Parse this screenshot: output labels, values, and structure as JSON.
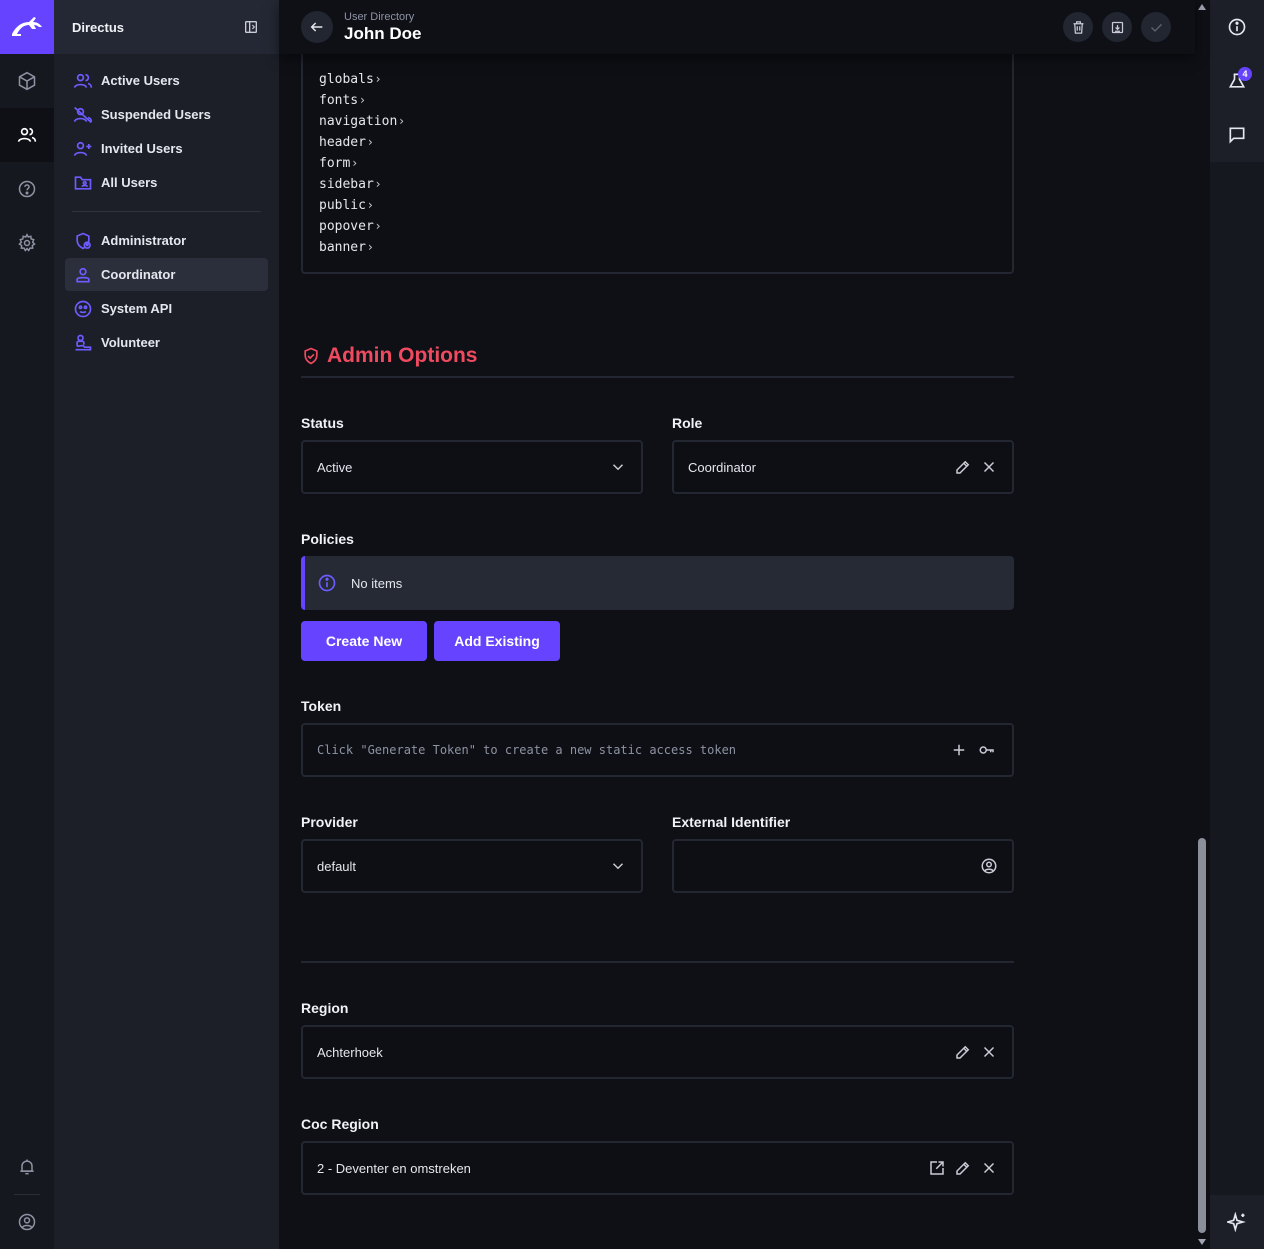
{
  "nav": {
    "title": "Directus",
    "items": [
      {
        "label": "Active Users"
      },
      {
        "label": "Suspended Users"
      },
      {
        "label": "Invited Users"
      },
      {
        "label": "All Users"
      },
      {
        "label": "Administrator"
      },
      {
        "label": "Coordinator"
      },
      {
        "label": "System API"
      },
      {
        "label": "Volunteer"
      }
    ],
    "active": "Coordinator"
  },
  "header": {
    "breadcrumb": "User Directory",
    "title": "John Doe"
  },
  "code_lines": [
    {
      "text": "globals"
    },
    {
      "text": "fonts"
    },
    {
      "text": "navigation"
    },
    {
      "text": "header"
    },
    {
      "text": "form"
    },
    {
      "text": "sidebar"
    },
    {
      "text": "public"
    },
    {
      "text": "popover"
    },
    {
      "text": "banner"
    }
  ],
  "admin": {
    "section_title": "Admin Options",
    "status_label": "Status",
    "status_value": "Active",
    "role_label": "Role",
    "role_value": "Coordinator",
    "policies_label": "Policies",
    "policies_empty": "No items",
    "create_new_label": "Create New",
    "add_existing_label": "Add Existing",
    "token_label": "Token",
    "token_placeholder": "Click \"Generate Token\" to create a new static access token",
    "provider_label": "Provider",
    "provider_value": "default",
    "external_id_label": "External Identifier",
    "external_id_value": ""
  },
  "region": {
    "region_label": "Region",
    "region_value": "Achterhoek",
    "coc_region_label": "Coc Region",
    "coc_region_value": "2 - Deventer en omstreken"
  },
  "notifications": {
    "count": "4"
  },
  "colors": {
    "accent": "#6644ff",
    "danger": "#ef4a5f",
    "background": "#0e1016"
  }
}
